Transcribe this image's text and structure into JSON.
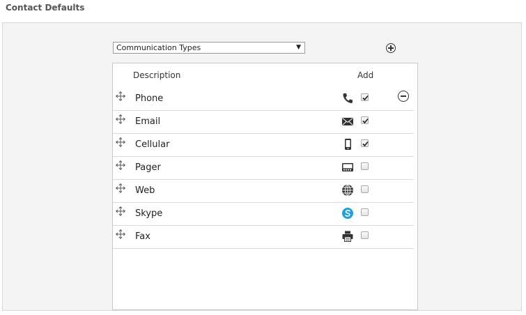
{
  "page_title": "Contact Defaults",
  "type_select": {
    "selected": "Communication Types",
    "arrow": "▼"
  },
  "list": {
    "header_description": "Description",
    "header_add": "Add",
    "rows": [
      {
        "label": "Phone",
        "icon": "phone-icon",
        "add_checked": true
      },
      {
        "label": "Email",
        "icon": "envelope-icon",
        "add_checked": true
      },
      {
        "label": "Cellular",
        "icon": "mobile-icon",
        "add_checked": true
      },
      {
        "label": "Pager",
        "icon": "pager-icon",
        "add_checked": false
      },
      {
        "label": "Web",
        "icon": "globe-icon",
        "add_checked": false
      },
      {
        "label": "Skype",
        "icon": "skype-icon",
        "add_checked": false
      },
      {
        "label": "Fax",
        "icon": "printer-icon",
        "add_checked": false
      }
    ]
  },
  "colors": {
    "skype": "#1da1e0",
    "panel_bg": "#f4f4f4",
    "border": "#d7d7d7"
  }
}
